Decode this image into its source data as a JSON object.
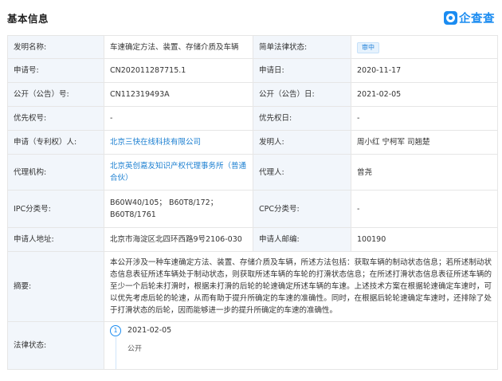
{
  "header": {
    "title": "基本信息",
    "logo_text": "企查查",
    "logo_icon": "qichacha-logo-icon"
  },
  "rows": {
    "r1": {
      "label1": "发明名称:",
      "value1": "车速确定方法、装置、存储介质及车辆",
      "label2": "简单法律状态:",
      "value2": "审中"
    },
    "r2": {
      "label1": "申请号:",
      "value1": "CN202011287715.1",
      "label2": "申请日:",
      "value2": "2020-11-17"
    },
    "r3": {
      "label1": "公开（公告）号:",
      "value1": "CN112319493A",
      "label2": "公开（公告）日:",
      "value2": "2021-02-05"
    },
    "r4": {
      "label1": "优先权号:",
      "value1": "-",
      "label2": "优先权日:",
      "value2": "-"
    },
    "r5": {
      "label1": "申请（专利权）人:",
      "value1": "北京三快在线科技有限公司",
      "label2": "发明人:",
      "value2": "周小红 宁柯军 司翘楚"
    },
    "r6": {
      "label1": "代理机构:",
      "value1": "北京英创嘉友知识产权代理事务所（普通合伙）",
      "label2": "代理人:",
      "value2": "曾尧"
    },
    "r7": {
      "label1": "IPC分类号:",
      "value1": "B60W40/105； B60T8/172； B60T8/1761",
      "label2": "CPC分类号:",
      "value2": "-"
    },
    "r8": {
      "label1": "申请人地址:",
      "value1": "北京市海淀区北四环西路9号2106-030",
      "label2": "申请人邮编:",
      "value2": "100190"
    }
  },
  "abstract": {
    "label": "摘要:",
    "text": "本公开涉及一种车速确定方法、装置、存储介质及车辆，所述方法包括：获取车辆的制动状态信息；若所述制动状态信息表征所述车辆处于制动状态，则获取所述车辆的车轮的打滑状态信息；在所述打滑状态信息表征所述车辆的至少一个后轮未打滑时，根据未打滑的后轮的轮速确定所述车辆的车速。上述技术方案在根据轮速确定车速时，可以优先考虑后轮的轮速，从而有助于提升所确定的车速的准确性。同时，在根据后轮轮速确定车速时，还排除了处于打滑状态的后轮，因而能够进一步的提升所确定的车速的准确性。"
  },
  "legal": {
    "label": "法律状态:",
    "index": "1",
    "date": "2021-02-05",
    "status": "公开"
  },
  "colors": {
    "label_bg": "#f2f6fb",
    "border": "#e6e6e6",
    "link": "#1b7fd1",
    "accent": "#1b8cf1",
    "badge_bg": "#e6f2fd",
    "badge_text": "#2483d9"
  }
}
